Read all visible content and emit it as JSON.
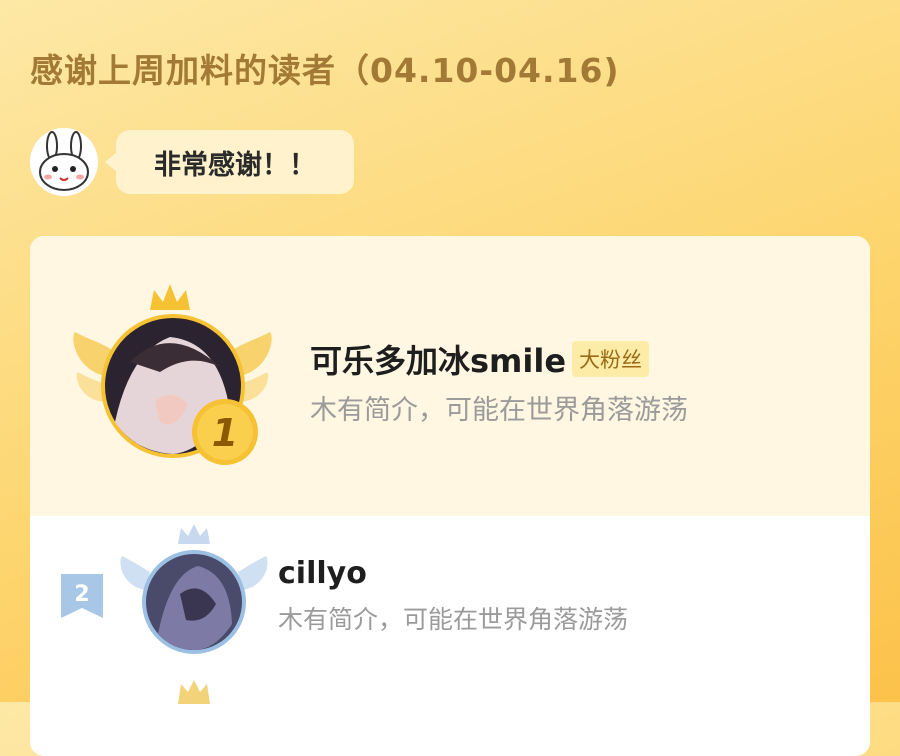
{
  "header": {
    "title": "感谢上周加料的读者（04.10-04.16)"
  },
  "mascot": {
    "icon": "bunny-avatar-icon",
    "bubble_text": "非常感谢！！"
  },
  "ranking": [
    {
      "rank": "1",
      "name": "可乐多加冰smile",
      "tag": "大粉丝",
      "desc": "木有简介，可能在世界角落游荡"
    },
    {
      "rank": "2",
      "name": "cillyo",
      "desc": "木有简介，可能在世界角落游荡"
    }
  ],
  "colors": {
    "title": "#a27a35",
    "gold": "#f6c233",
    "silver": "#9cc0e4"
  }
}
